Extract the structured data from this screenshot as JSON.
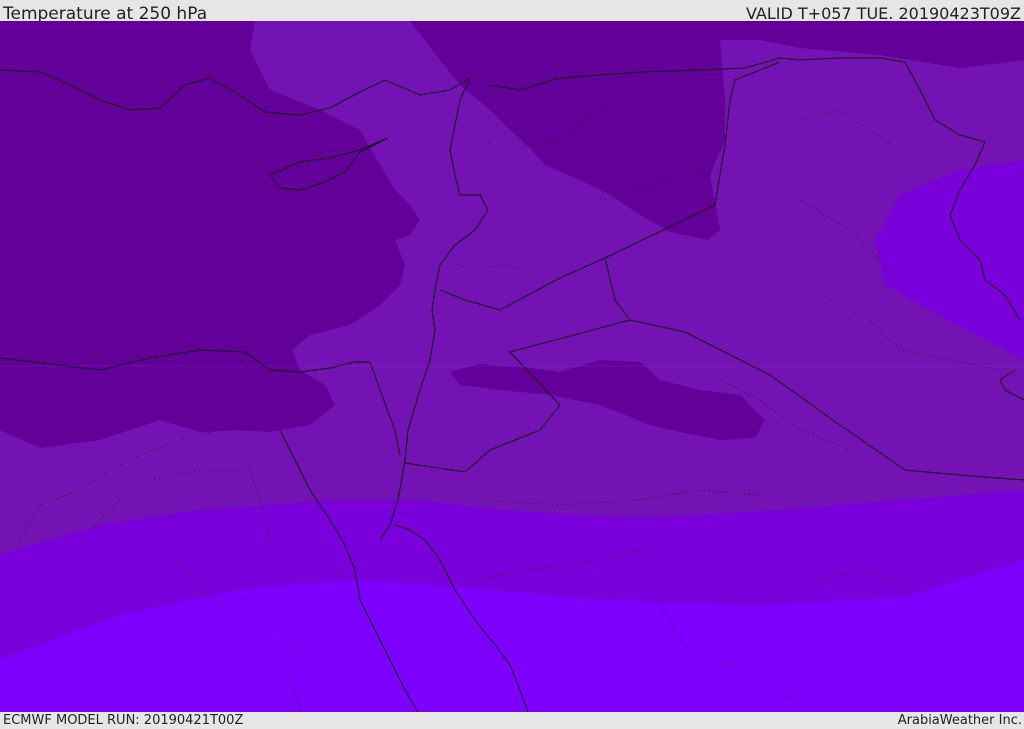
{
  "header": {
    "title": "Temperature at 250 hPa",
    "valid": "VALID T+057 TUE. 20190423T09Z"
  },
  "footer": {
    "model_run": "ECMWF MODEL RUN: 20190421T00Z",
    "credit": "ArabiaWeather Inc."
  },
  "colors": {
    "band_darkest": "#63009a",
    "band_dark": "#7313b3",
    "band_mid": "#7a00db",
    "band_light": "#7d00fe",
    "border_line": "#111111",
    "frame": "#e6e6e6"
  }
}
